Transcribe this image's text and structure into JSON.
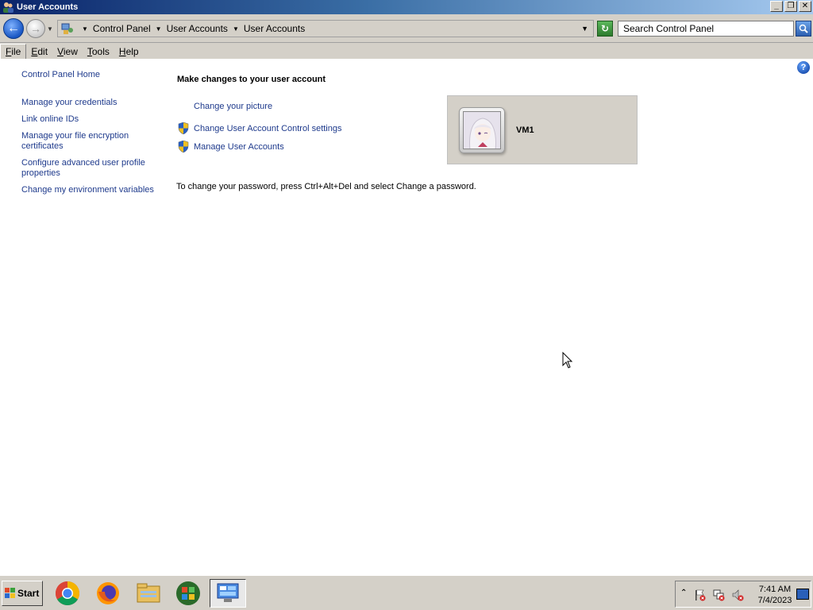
{
  "window": {
    "title": "User Accounts",
    "controls": {
      "minimize": "_",
      "restore": "❐",
      "close": "✕"
    }
  },
  "address_bar": {
    "breadcrumbs": [
      "Control Panel",
      "User Accounts",
      "User Accounts"
    ],
    "search_placeholder": "Search Control Panel"
  },
  "menu": {
    "items": [
      {
        "label": "File",
        "key": "F",
        "rest": "ile"
      },
      {
        "label": "Edit",
        "key": "E",
        "rest": "dit"
      },
      {
        "label": "View",
        "key": "V",
        "rest": "iew"
      },
      {
        "label": "Tools",
        "key": "T",
        "rest": "ools"
      },
      {
        "label": "Help",
        "key": "H",
        "rest": "elp"
      }
    ]
  },
  "left_nav": {
    "home": "Control Panel Home",
    "links": [
      "Manage your credentials",
      "Link online IDs",
      "Manage your file encryption certificates",
      "Configure advanced user profile properties",
      "Change my environment variables"
    ]
  },
  "main": {
    "heading": "Make changes to your user account",
    "tasks": [
      {
        "label": "Change your picture",
        "shield": false
      },
      {
        "label": "Change User Account Control settings",
        "shield": true
      },
      {
        "label": "Manage User Accounts",
        "shield": true
      }
    ],
    "info": "To change your password, press Ctrl+Alt+Del and select Change a password."
  },
  "user_tile": {
    "name": "VM1"
  },
  "taskbar": {
    "start_label": "Start",
    "apps": [
      "chrome-icon",
      "firefox-icon",
      "file-explorer-icon",
      "windows-media-icon",
      "control-panel-icon"
    ],
    "clock_time": "7:41 AM",
    "clock_date": "7/4/2023"
  },
  "colors": {
    "link": "#1e3a8c",
    "window_bg": "#d4d0c8",
    "title_gradient_start": "#0a246a"
  }
}
